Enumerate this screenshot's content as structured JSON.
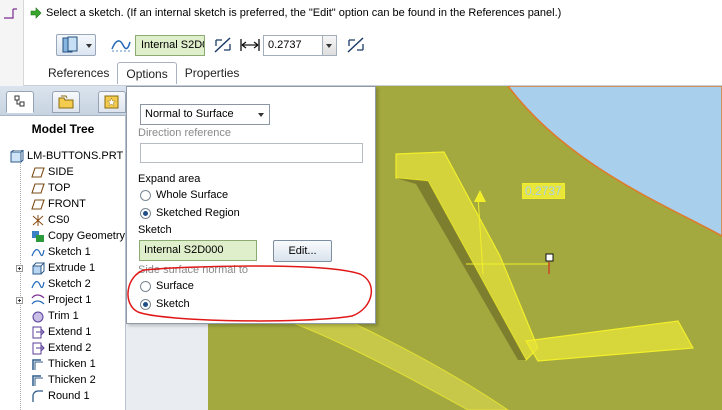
{
  "message": {
    "text": "Select a sketch. (If an internal sketch is preferred, the \"Edit\" option can be found in the References panel.)"
  },
  "toolbar": {
    "sketch_value": "Internal S2D0",
    "thickness_value": "0.2737",
    "icons": [
      "surface-type-icon",
      "sketch-icon",
      "flip-direction-icon",
      "thickness-dimension-icon",
      "flip-thickness-icon"
    ]
  },
  "tabs": [
    {
      "label": "References"
    },
    {
      "label": "Options",
      "active": true
    },
    {
      "label": "Properties"
    }
  ],
  "model_tree": {
    "title": "Model Tree",
    "items": [
      {
        "label": "LM-BUTTONS.PRT",
        "icon": "part-icon"
      },
      {
        "label": "SIDE",
        "icon": "datum-plane-icon"
      },
      {
        "label": "TOP",
        "icon": "datum-plane-icon"
      },
      {
        "label": "FRONT",
        "icon": "datum-plane-icon"
      },
      {
        "label": "CS0",
        "icon": "coordinate-system-icon"
      },
      {
        "label": "Copy Geometry",
        "icon": "copy-geometry-icon"
      },
      {
        "label": "Sketch 1",
        "icon": "sketch-icon"
      },
      {
        "label": "Extrude 1",
        "icon": "extrude-icon",
        "expandable": true
      },
      {
        "label": "Sketch 2",
        "icon": "sketch-icon"
      },
      {
        "label": "Project 1",
        "icon": "project-icon",
        "expandable": true
      },
      {
        "label": "Trim 1",
        "icon": "trim-icon"
      },
      {
        "label": "Extend 1",
        "icon": "extend-icon"
      },
      {
        "label": "Extend 2",
        "icon": "extend-icon"
      },
      {
        "label": "Thicken 1",
        "icon": "thicken-icon"
      },
      {
        "label": "Thicken 2",
        "icon": "thicken-icon"
      },
      {
        "label": "Round 1",
        "icon": "round-icon"
      }
    ]
  },
  "options_panel": {
    "dropdown_value": "Normal to Surface",
    "direction_reference_label": "Direction reference",
    "expand_area_label": "Expand area",
    "expand_options": [
      {
        "label": "Whole Surface",
        "selected": false
      },
      {
        "label": "Sketched Region",
        "selected": true
      }
    ],
    "sketch_label": "Sketch",
    "sketch_value": "Internal S2D000",
    "edit_button": "Edit...",
    "side_surface_label": "Side surface normal to",
    "side_options": [
      {
        "label": "Surface",
        "selected": false
      },
      {
        "label": "Sketch",
        "selected": true
      }
    ]
  },
  "graphics": {
    "dimension_value": "0.2737",
    "colors": {
      "surface": "#a3a83f",
      "feature_yellow": "#f2ef2a",
      "sky": "#a8cfec",
      "annotation": "#e01818"
    }
  }
}
